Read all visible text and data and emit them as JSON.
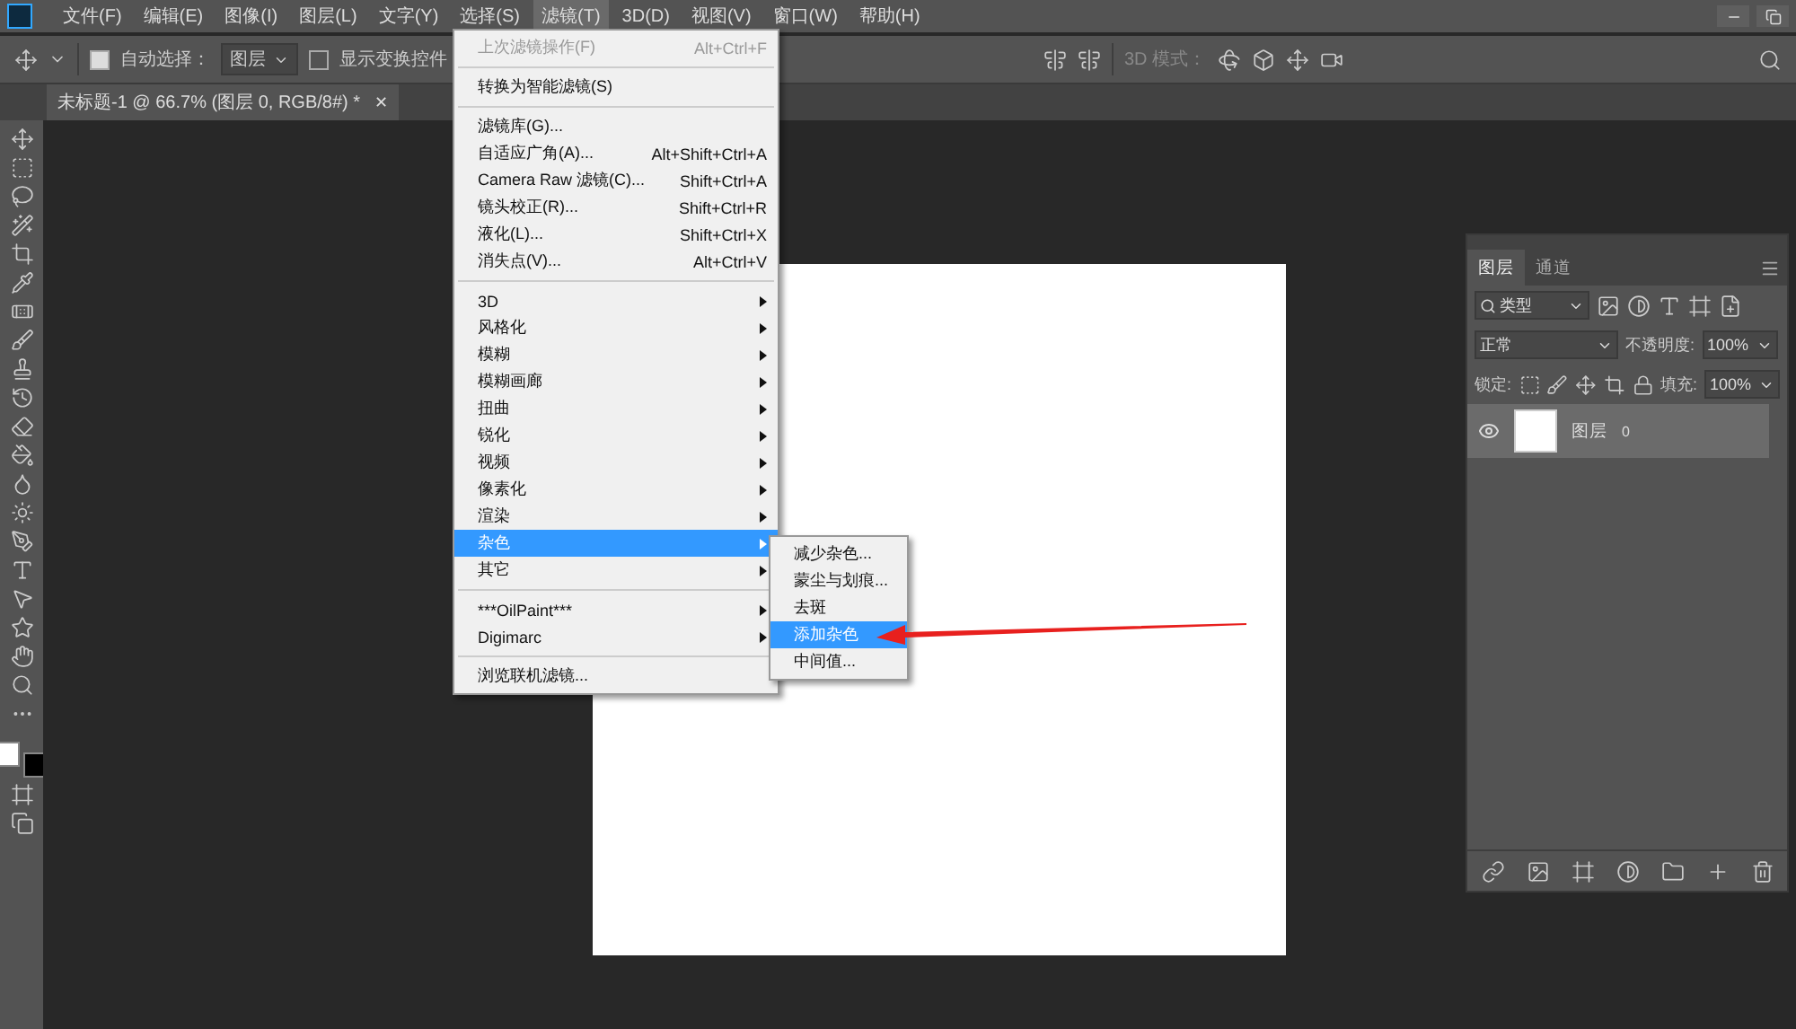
{
  "menubar": {
    "items": [
      {
        "label": "文件(F)",
        "selected": false
      },
      {
        "label": "编辑(E)",
        "selected": false
      },
      {
        "label": "图像(I)",
        "selected": false
      },
      {
        "label": "图层(L)",
        "selected": false
      },
      {
        "label": "文字(Y)",
        "selected": false
      },
      {
        "label": "选择(S)",
        "selected": false
      },
      {
        "label": "滤镜(T)",
        "selected": true
      },
      {
        "label": "3D(D)",
        "selected": false
      },
      {
        "label": "视图(V)",
        "selected": false
      },
      {
        "label": "窗口(W)",
        "selected": false
      },
      {
        "label": "帮助(H)",
        "selected": false
      }
    ]
  },
  "options_bar": {
    "auto_select": {
      "label": "自动选择：",
      "checked": true
    },
    "auto_select_target": "图层",
    "show_transform": {
      "label": "显示变换控件",
      "checked": false
    },
    "mode_3d_label": "3D 模式："
  },
  "document_tab": {
    "title": "未标题-1 @ 66.7% (图层 0, RGB/8#) *",
    "close_symbol": "✕"
  },
  "filter_menu": {
    "sections": [
      [
        {
          "label": "上次滤镜操作(F)",
          "shortcut": "Alt+Ctrl+F",
          "disabled": true,
          "submenu": false,
          "selected": false
        }
      ],
      [
        {
          "label": "转换为智能滤镜(S)",
          "disabled": false,
          "submenu": false,
          "selected": false
        }
      ],
      [
        {
          "label": "滤镜库(G)...",
          "disabled": false,
          "submenu": false,
          "selected": false
        },
        {
          "label": "自适应广角(A)...",
          "shortcut": "Alt+Shift+Ctrl+A",
          "disabled": false,
          "submenu": false,
          "selected": false
        },
        {
          "label": "Camera Raw 滤镜(C)...",
          "shortcut": "Shift+Ctrl+A",
          "disabled": false,
          "submenu": false,
          "selected": false
        },
        {
          "label": "镜头校正(R)...",
          "shortcut": "Shift+Ctrl+R",
          "disabled": false,
          "submenu": false,
          "selected": false
        },
        {
          "label": "液化(L)...",
          "shortcut": "Shift+Ctrl+X",
          "disabled": false,
          "submenu": false,
          "selected": false
        },
        {
          "label": "消失点(V)...",
          "shortcut": "Alt+Ctrl+V",
          "disabled": false,
          "submenu": false,
          "selected": false
        }
      ],
      [
        {
          "label": "3D",
          "disabled": false,
          "submenu": true,
          "selected": false
        },
        {
          "label": "风格化",
          "disabled": false,
          "submenu": true,
          "selected": false
        },
        {
          "label": "模糊",
          "disabled": false,
          "submenu": true,
          "selected": false
        },
        {
          "label": "模糊画廊",
          "disabled": false,
          "submenu": true,
          "selected": false
        },
        {
          "label": "扭曲",
          "disabled": false,
          "submenu": true,
          "selected": false
        },
        {
          "label": "锐化",
          "disabled": false,
          "submenu": true,
          "selected": false
        },
        {
          "label": "视频",
          "disabled": false,
          "submenu": true,
          "selected": false
        },
        {
          "label": "像素化",
          "disabled": false,
          "submenu": true,
          "selected": false
        },
        {
          "label": "渲染",
          "disabled": false,
          "submenu": true,
          "selected": false
        },
        {
          "label": "杂色",
          "disabled": false,
          "submenu": true,
          "selected": true
        },
        {
          "label": "其它",
          "disabled": false,
          "submenu": true,
          "selected": false
        }
      ],
      [
        {
          "label": "***OilPaint***",
          "disabled": false,
          "submenu": true,
          "selected": false
        },
        {
          "label": "Digimarc",
          "disabled": false,
          "submenu": true,
          "selected": false
        }
      ],
      [
        {
          "label": "浏览联机滤镜...",
          "disabled": false,
          "submenu": false,
          "selected": false
        }
      ]
    ]
  },
  "noise_submenu": {
    "items": [
      {
        "label": "减少杂色...",
        "selected": false
      },
      {
        "label": "蒙尘与划痕...",
        "selected": false
      },
      {
        "label": "去斑",
        "selected": false
      },
      {
        "label": "添加杂色",
        "selected": true
      },
      {
        "label": "中间值...",
        "selected": false
      }
    ]
  },
  "layers_panel": {
    "tabs": [
      {
        "label": "图层",
        "selected": true
      },
      {
        "label": "通道",
        "selected": false
      }
    ],
    "filter_kind": "类型",
    "blend_mode": "正常",
    "opacity_label": "不透明度:",
    "opacity": "100%",
    "lock_label": "锁定:",
    "fill_label": "填充:",
    "fill": "100%",
    "layers": [
      {
        "name": "图层",
        "index": "0",
        "visible": true,
        "selected": true
      }
    ]
  }
}
